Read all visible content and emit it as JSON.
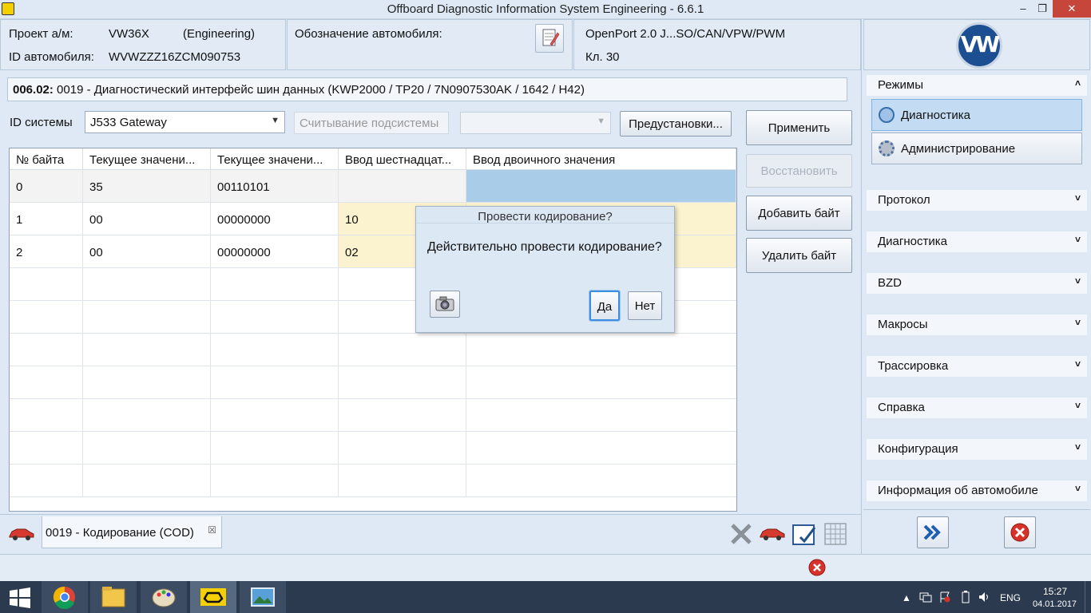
{
  "window": {
    "title": "Offboard Diagnostic Information System Engineering - 6.6.1",
    "minimize": "–",
    "restore": "❐",
    "close": "✕"
  },
  "header": {
    "project_label": "Проект а/м:",
    "project_value": "VW36X",
    "project_mode": "(Engineering)",
    "vin_label": "ID автомобиля:",
    "vin_value": "WVWZZZ16ZCM090753",
    "vehicle_designation_label": "Обозначение автомобиля:",
    "interface": "OpenPort 2.0 J...SO/CAN/VPW/PWM",
    "terminal": "Кл. 30"
  },
  "main": {
    "headline_code": "006.02:",
    "headline_text": " 0019 - Диагностический интерфейс шин данных  (KWP2000 / TP20 / 7N0907530AK / 1642 / H42)",
    "system_id_label": "ID системы",
    "system_id_value": "J533  Gateway",
    "subsystem_read_button": "Считывание подсистемы",
    "subsystem_select_value": "",
    "presets_button": "Предустановки...",
    "apply_button": "Применить",
    "restore_button": "Восстановить",
    "add_byte_button": "Добавить байт",
    "delete_byte_button": "Удалить байт"
  },
  "table": {
    "columns": [
      "№ байта",
      "Текущее значени...",
      "Текущее значени...",
      "Ввод шестнадцат...",
      "Ввод двоичного значения"
    ],
    "rows": [
      [
        "0",
        "35",
        "00110101",
        "",
        ""
      ],
      [
        "1",
        "00",
        "00000000",
        "10",
        ""
      ],
      [
        "2",
        "00",
        "00000000",
        "02",
        ""
      ]
    ]
  },
  "dialog": {
    "title": "Провести кодирование?",
    "message": "Действительно провести кодирование?",
    "yes_button": "Да",
    "no_button": "Нет",
    "screenshot_icon": "camera-icon"
  },
  "right_panel": {
    "logo": "VW",
    "modes_header": "Режимы",
    "modes": [
      "Диагностика",
      "Администрирование"
    ],
    "sections": [
      "Протокол",
      "Диагностика",
      "BZD",
      "Макросы",
      "Трассировка",
      "Справка",
      "Конфигурация",
      "Информация об автомобиле"
    ]
  },
  "tabs": {
    "active_tab": "0019 - Кодирование (COD)",
    "close_glyph": "☒"
  },
  "taskbar": {
    "lang": "ENG",
    "time": "15:27",
    "date": "04.01.2017"
  },
  "colors": {
    "selected_cell": "#a9cce8",
    "edited_row": "#fbf3cf",
    "accent_blue": "#1c4f92",
    "close_red": "#d8312a"
  }
}
